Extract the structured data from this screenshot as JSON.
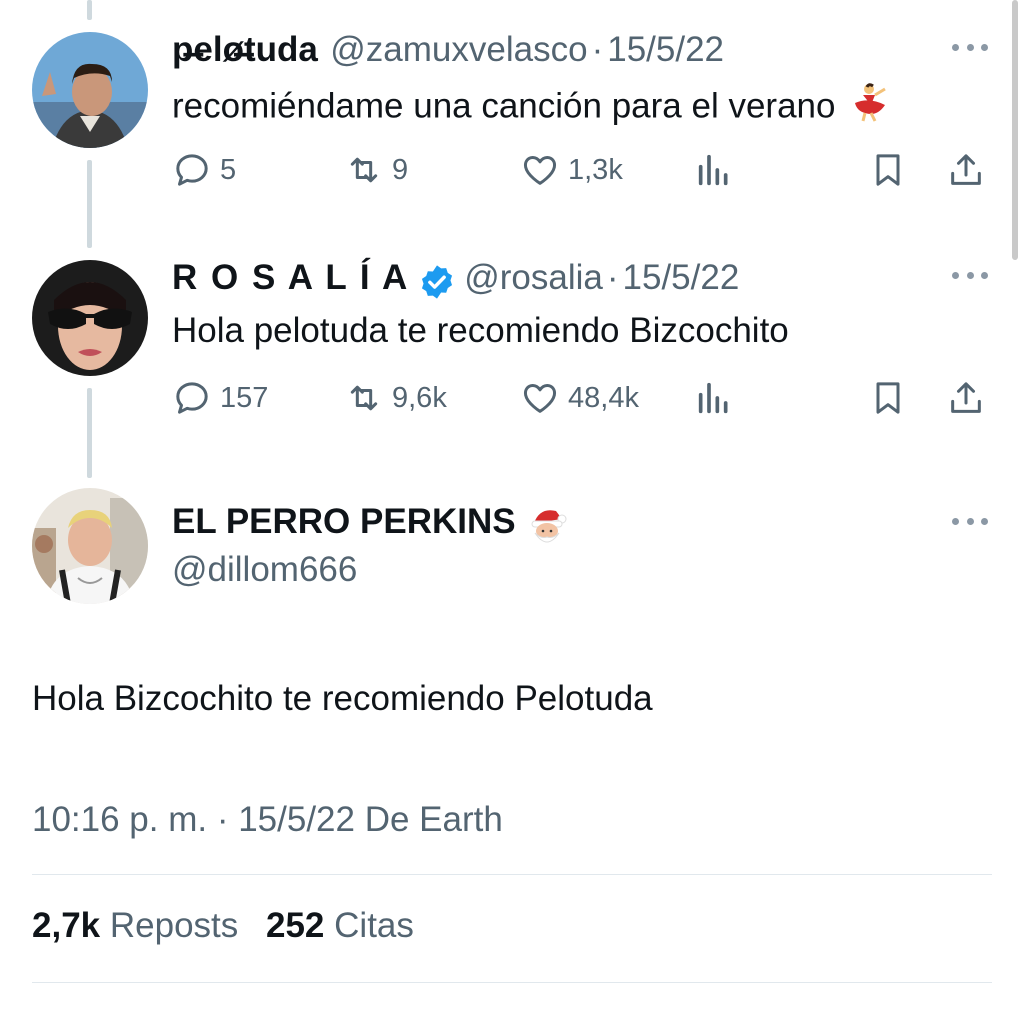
{
  "tweets": [
    {
      "name": "p̶elø̶tuda",
      "handle": "@zamuxvelasco",
      "sep": "·",
      "date": "15/5/22",
      "text": "recomiéndame una canción para el verano",
      "emoji_icon": "dancer-emoji",
      "replies": "5",
      "reposts": "9",
      "likes": "1,3k"
    },
    {
      "name": "R O S A L Í A",
      "handle": "@rosalia",
      "sep": "·",
      "date": "15/5/22",
      "text": "Hola pelotuda te recomiendo Bizcochito",
      "verified": true,
      "replies": "157",
      "reposts": "9,6k",
      "likes": "48,4k"
    }
  ],
  "main_tweet": {
    "name": "EL PERRO PERKINS",
    "name_emoji_icon": "santa-emoji",
    "handle": "@dillom666",
    "text": "Hola Bizcochito te recomiendo Pelotuda",
    "timestamp": "10:16 p. m. · 15/5/22 De Earth",
    "reposts_count": "2,7k",
    "reposts_label": "Reposts",
    "quotes_count": "252",
    "quotes_label": "Citas"
  },
  "colors": {
    "text": "#0f1419",
    "secondary": "#536471",
    "verified": "#1d9bf0",
    "thread_line": "#cfd9de"
  }
}
